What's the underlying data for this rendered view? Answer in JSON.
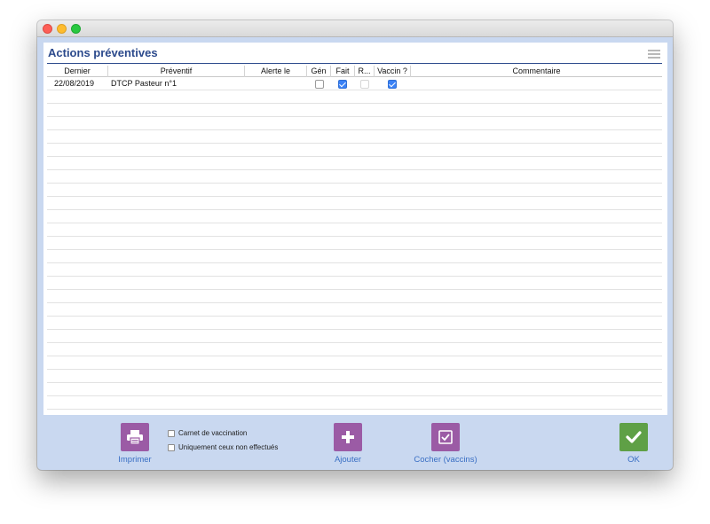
{
  "panel": {
    "title": "Actions préventives"
  },
  "columns": [
    {
      "key": "dernier",
      "label": "Dernier"
    },
    {
      "key": "preventif",
      "label": "Préventif"
    },
    {
      "key": "alerte",
      "label": "Alerte le"
    },
    {
      "key": "gen",
      "label": "Gén"
    },
    {
      "key": "fait",
      "label": "Fait"
    },
    {
      "key": "r",
      "label": "R..."
    },
    {
      "key": "vaccin",
      "label": "Vaccin ?"
    },
    {
      "key": "commentaire",
      "label": "Commentaire"
    }
  ],
  "rows": [
    {
      "dernier": "22/08/2019",
      "preventif": "DTCP Pasteur n°1",
      "alerte": "",
      "gen": false,
      "fait": true,
      "r": false,
      "vaccin": true,
      "commentaire": ""
    }
  ],
  "options": [
    {
      "label": "Carnet de vaccination",
      "checked": false
    },
    {
      "label": "Uniquement ceux non effectués",
      "checked": false
    }
  ],
  "buttons": {
    "print": {
      "label": "Imprimer",
      "icon": "printer-icon",
      "color": "#9b5ba5"
    },
    "add": {
      "label": "Ajouter",
      "icon": "plus-icon",
      "color": "#9b5ba5"
    },
    "check": {
      "label": "Cocher (vaccins)",
      "icon": "checkbox-icon",
      "color": "#9b5ba5"
    },
    "ok": {
      "label": "OK",
      "icon": "checkmark-icon",
      "color": "#5fa046"
    }
  }
}
